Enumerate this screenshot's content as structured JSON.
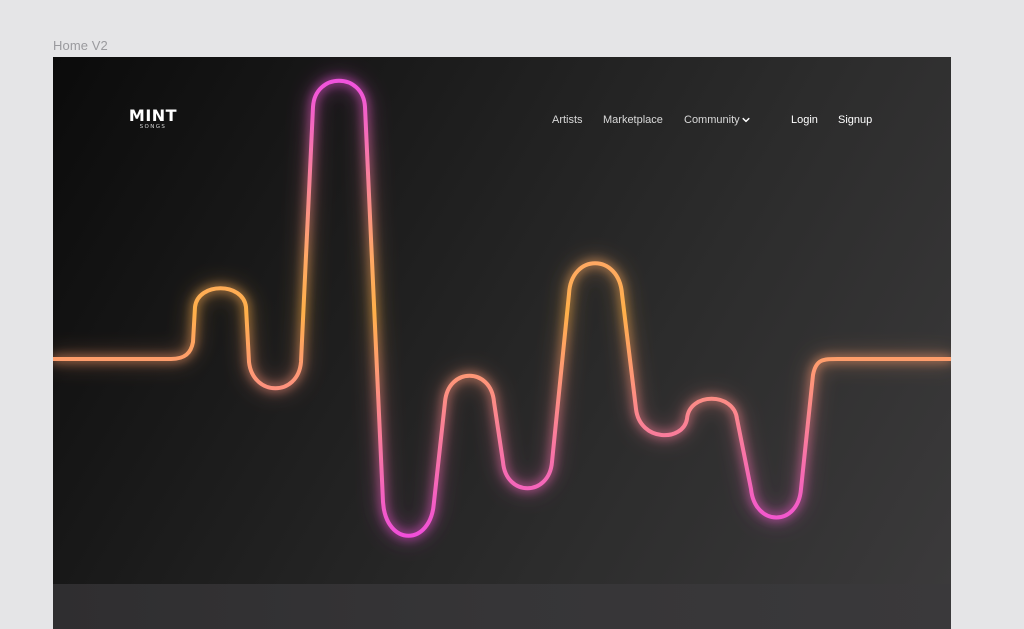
{
  "canvas": {
    "frame_label": "Home V2"
  },
  "brand": {
    "logo_main": "MINT",
    "logo_sub": "SONGS"
  },
  "nav": {
    "items": [
      {
        "label": "Artists"
      },
      {
        "label": "Marketplace"
      },
      {
        "label": "Community"
      }
    ],
    "login_label": "Login",
    "signup_label": "Signup"
  },
  "icons": {
    "community_dropdown": "chevron-down-icon"
  },
  "colors": {
    "wave_orange": "#ffb347",
    "wave_magenta": "#ff4fd8",
    "hero_background_dark": "#0b0b0b",
    "hero_background_light": "#3b3a3b",
    "page_background": "#e5e5e7"
  }
}
